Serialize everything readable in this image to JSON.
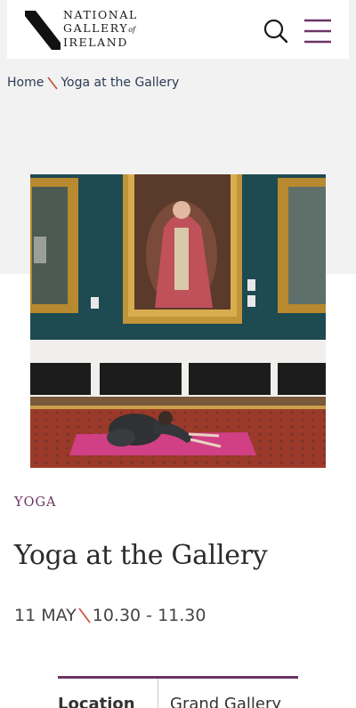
{
  "header": {
    "logo_lines": [
      "NATIONAL",
      "GALLERY",
      "IRELAND"
    ],
    "logo_small": "of",
    "search_icon": "search-icon",
    "menu_icon": "hamburger-menu-icon"
  },
  "breadcrumb": {
    "home": "Home",
    "current": "Yoga at the Gallery"
  },
  "event": {
    "category": "YOGA",
    "title": "Yoga at the Gallery",
    "date": "11 MAY",
    "time": "10.30 - 11.30"
  },
  "details": {
    "location_label": "Location",
    "location_value": "Grand Gallery"
  },
  "colors": {
    "accent": "#6b3466",
    "separator": "#c9573a",
    "wall": "#1e4a52",
    "mat": "#d13f84"
  }
}
